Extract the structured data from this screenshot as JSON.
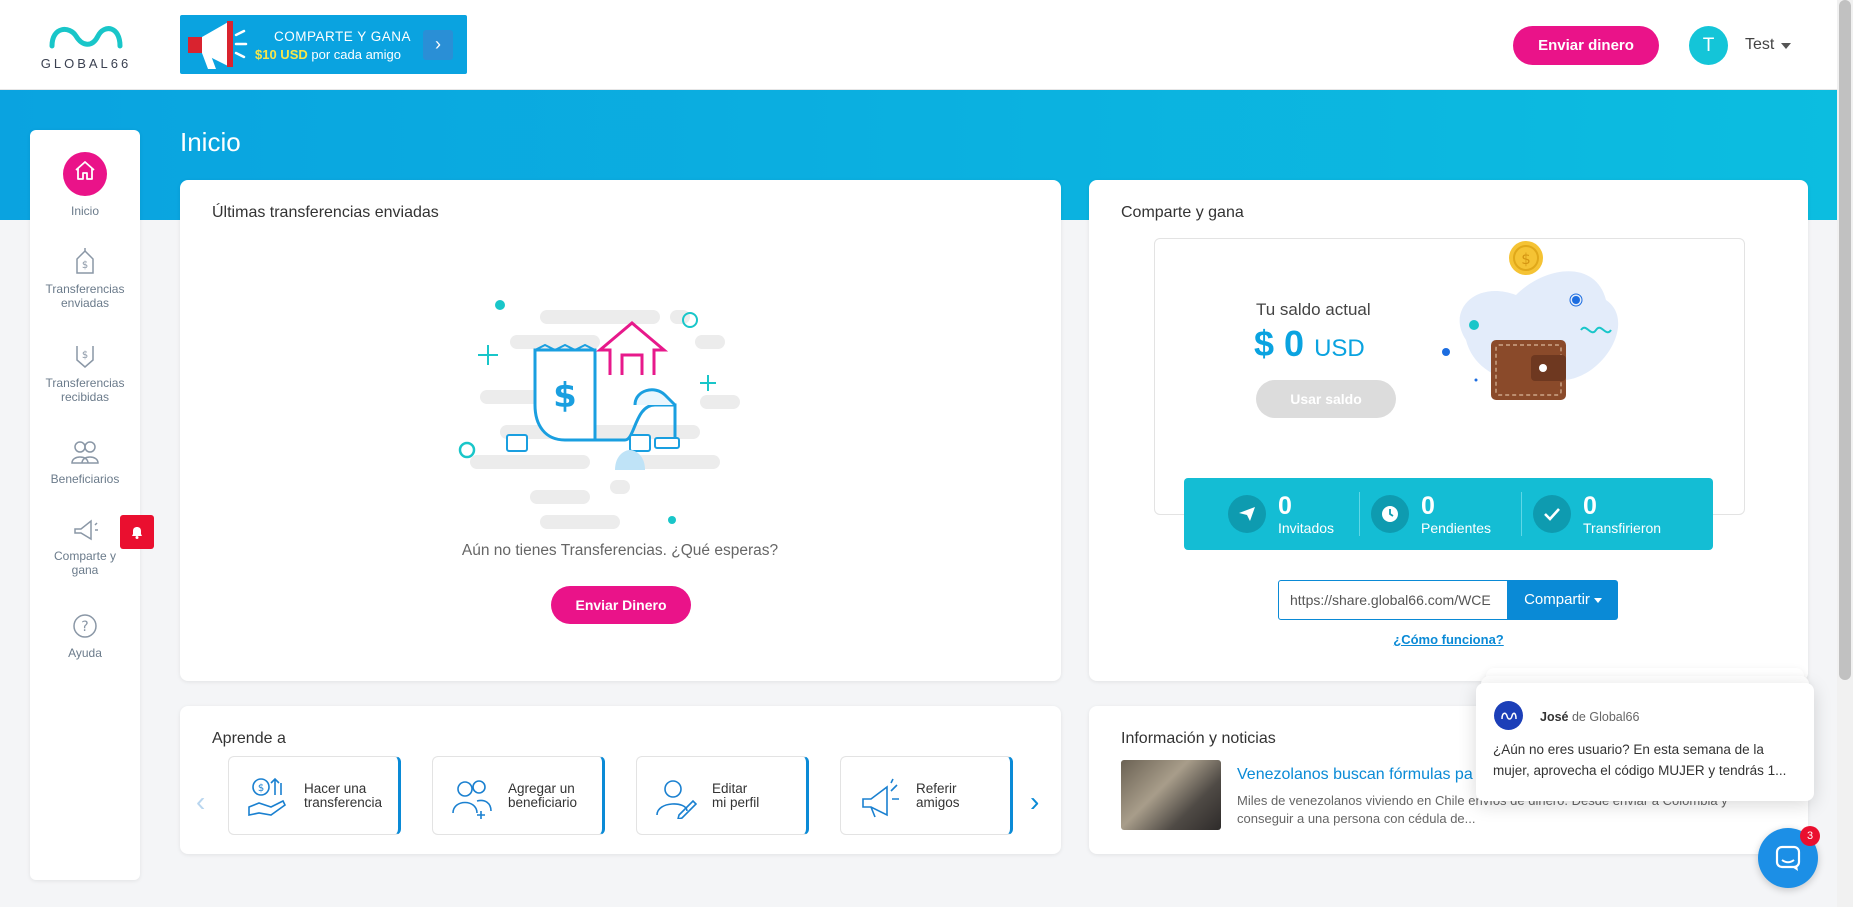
{
  "header": {
    "logo_text": "GLOBAL66",
    "promo_line1": "COMPARTE Y GANA",
    "promo_amount": "$10 USD",
    "promo_rest": "por cada amigo",
    "send_button": "Enviar dinero",
    "avatar_initial": "T",
    "user_name": "Test"
  },
  "page": {
    "title": "Inicio"
  },
  "sidebar": {
    "items": [
      {
        "label": "Inicio"
      },
      {
        "label": "Transferencias enviadas"
      },
      {
        "label": "Transferencias recibidas"
      },
      {
        "label": "Beneficiarios"
      },
      {
        "label": "Comparte y gana"
      },
      {
        "label": "Ayuda"
      }
    ]
  },
  "transfers": {
    "title": "Últimas transferencias enviadas",
    "empty_message": "Aún no tienes Transferencias. ¿Qué esperas?",
    "send_button": "Enviar Dinero"
  },
  "share": {
    "title": "Comparte y gana",
    "balance_label": "Tu saldo actual",
    "balance_symbol": "$",
    "balance_value": "0",
    "balance_currency": "USD",
    "use_balance": "Usar saldo",
    "stats": [
      {
        "value": "0",
        "label": "Invitados"
      },
      {
        "value": "0",
        "label": "Pendientes"
      },
      {
        "value": "0",
        "label": "Transfirieron"
      }
    ],
    "link_value": "https://share.global66.com/WCE",
    "share_button": "Compartir",
    "how_link": "¿Cómo funciona?"
  },
  "learn": {
    "title": "Aprende a",
    "items": [
      {
        "line1": "Hacer una",
        "line2": "transferencia"
      },
      {
        "line1": "Agregar un",
        "line2": "beneficiario"
      },
      {
        "line1": "Editar",
        "line2": "mi perfil"
      },
      {
        "line1": "Referir",
        "line2": "amigos"
      }
    ]
  },
  "news": {
    "title": "Información y noticias",
    "headline": "Venezolanos buscan fórmulas pa",
    "body": "Miles de venezolanos viviendo en Chile envíos de dinero. Desde enviar a Colombia y conseguir a una persona con cédula de..."
  },
  "chat": {
    "sender": "José",
    "sender_suffix": "de Global66",
    "message": "¿Aún no eres usuario? En esta semana de la mujer, aprovecha el código MUJER y tendrás 1...",
    "unread_count": "3"
  },
  "colors": {
    "primary": "#0aa3e0",
    "accent": "#ea1389",
    "teal": "#14bdd4",
    "link": "#0a8ad6"
  }
}
